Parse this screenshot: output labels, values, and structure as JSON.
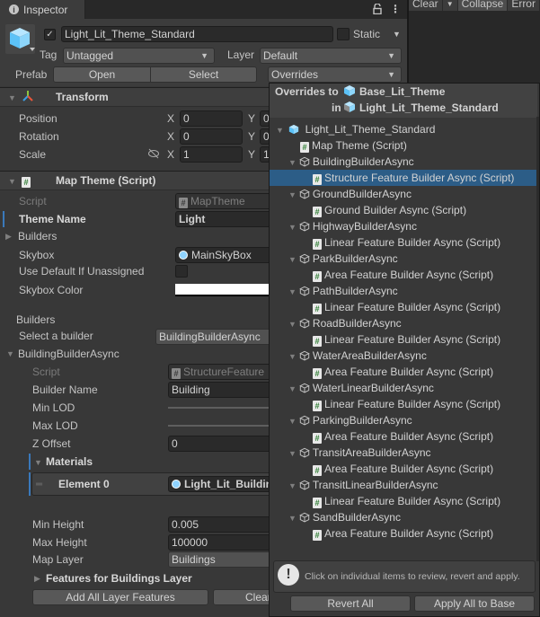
{
  "tab": {
    "title": "Inspector"
  },
  "console_toolbar": {
    "clear": "Clear",
    "collapse": "Collapse",
    "error": "Error"
  },
  "header": {
    "active": true,
    "name": "Light_Lit_Theme_Standard",
    "static_label": "Static",
    "tag_label": "Tag",
    "tag_value": "Untagged",
    "layer_label": "Layer",
    "layer_value": "Default",
    "prefab_label": "Prefab",
    "open_label": "Open",
    "select_label": "Select",
    "overrides_label": "Overrides"
  },
  "transform": {
    "title": "Transform",
    "rows": [
      {
        "label": "Position",
        "x": "0",
        "y": "0"
      },
      {
        "label": "Rotation",
        "x": "0",
        "y": "0"
      },
      {
        "label": "Scale",
        "x": "1",
        "y": "1"
      }
    ],
    "x_axis": "X",
    "y_axis": "Y"
  },
  "map_theme": {
    "title": "Map Theme (Script)",
    "script_label": "Script",
    "script_value": "MapTheme",
    "theme_name_label": "Theme Name",
    "theme_name_value": "Light",
    "builders_fold": "Builders",
    "skybox_label": "Skybox",
    "skybox_value": "MainSkyBox",
    "use_default_label": "Use Default If Unassigned",
    "skybox_color_label": "Skybox Color",
    "skybox_color": "#ffffff",
    "builders_header": "Builders",
    "select_builder_label": "Select a builder",
    "select_builder_value": "BuildingBuilderAsync",
    "builder_fold": "BuildingBuilderAsync",
    "builder": {
      "script_label": "Script",
      "script_value": "StructureFeature",
      "name_label": "Builder Name",
      "name_value": "Building",
      "min_lod_label": "Min LOD",
      "max_lod_label": "Max LOD",
      "z_offset_label": "Z Offset",
      "z_offset_value": "0",
      "materials_label": "Materials",
      "element0_label": "Element 0",
      "element0_value": "Light_Lit_Building",
      "min_height_label": "Min Height",
      "min_height_value": "0.005",
      "max_height_label": "Max Height",
      "max_height_value": "100000",
      "map_layer_label": "Map Layer",
      "map_layer_value": "Buildings",
      "features_fold": "Features for Buildings Layer",
      "add_all_label": "Add All Layer Features",
      "clear_label": "Clear"
    }
  },
  "overrides_popup": {
    "overrides_to": "Overrides to",
    "base_name": "Base_Lit_Theme",
    "in_label": "in",
    "instance_name": "Light_Lit_Theme_Standard",
    "root": "Light_Lit_Theme_Standard",
    "root_script": "Map Theme (Script)",
    "items": [
      {
        "object": "BuildingBuilderAsync",
        "script": "Structure Feature Builder Async (Script)",
        "selected": true
      },
      {
        "object": "GroundBuilderAsync",
        "script": "Ground Builder Async (Script)"
      },
      {
        "object": "HighwayBuilderAsync",
        "script": "Linear Feature Builder Async (Script)"
      },
      {
        "object": "ParkBuilderAsync",
        "script": "Area Feature Builder Async (Script)"
      },
      {
        "object": "PathBuilderAsync",
        "script": "Linear Feature Builder Async (Script)"
      },
      {
        "object": "RoadBuilderAsync",
        "script": "Linear Feature Builder Async (Script)"
      },
      {
        "object": "WaterAreaBuilderAsync",
        "script": "Area Feature Builder Async (Script)"
      },
      {
        "object": "WaterLinearBuilderAsync",
        "script": "Linear Feature Builder Async (Script)"
      },
      {
        "object": "ParkingBuilderAsync",
        "script": "Area Feature Builder Async (Script)"
      },
      {
        "object": "TransitAreaBuilderAsync",
        "script": "Area Feature Builder Async (Script)"
      },
      {
        "object": "TransitLinearBuilderAsync",
        "script": "Linear Feature Builder Async (Script)"
      },
      {
        "object": "SandBuilderAsync",
        "script": "Area Feature Builder Async (Script)"
      }
    ],
    "help_text": "Click on individual items to review, revert and apply.",
    "revert_all": "Revert All",
    "apply_all": "Apply All to Base"
  }
}
